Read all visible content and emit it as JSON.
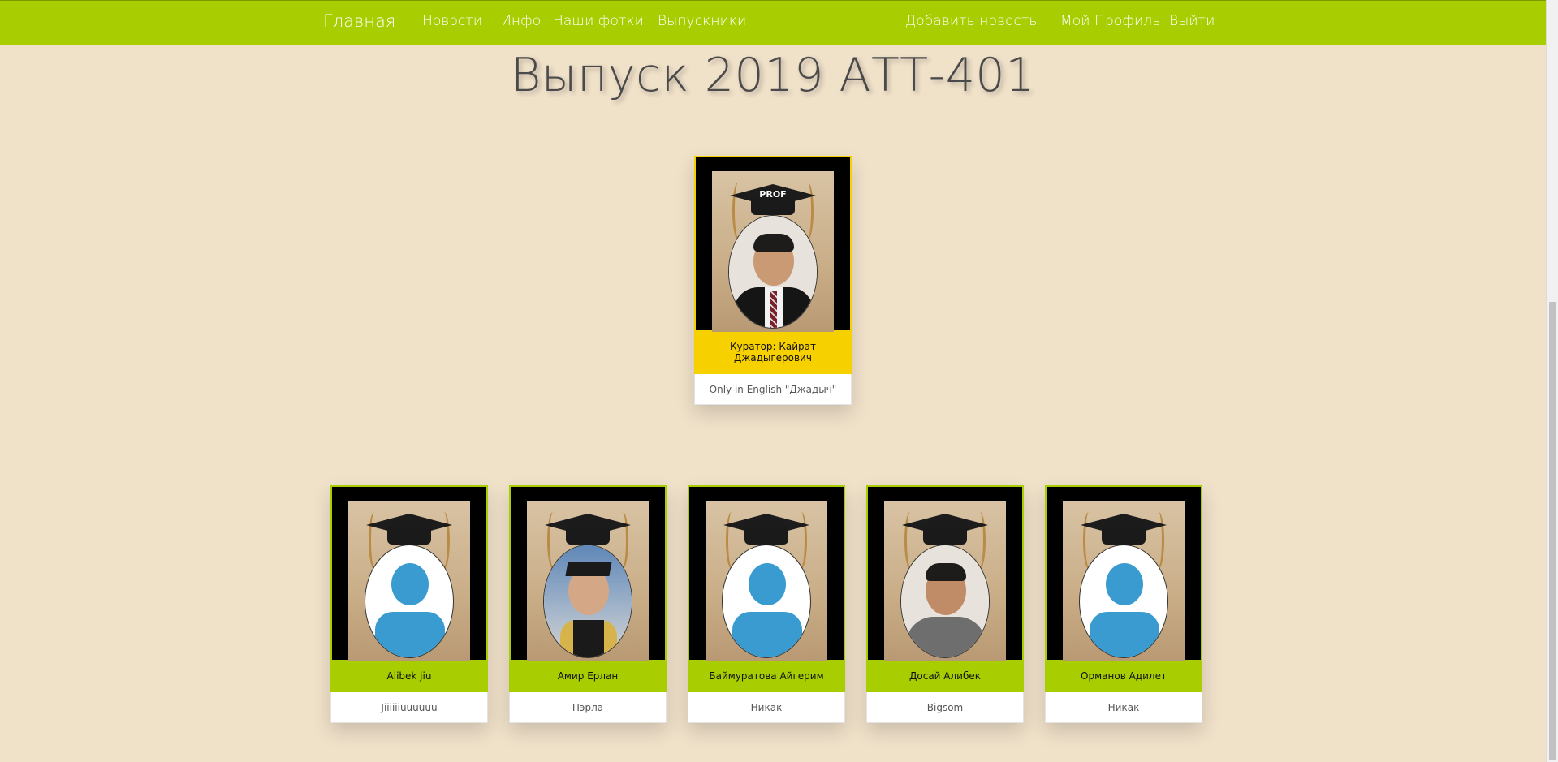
{
  "nav": {
    "brand": "Главная",
    "left_links": [
      "Новости",
      "Инфо",
      "Наши фотки",
      "Выпускники"
    ],
    "right_links": [
      "Добавить новость",
      "Мой Профиль",
      "Выйти"
    ],
    "bar_color": "#a8cd00"
  },
  "page": {
    "title": "Выпуск 2019 АТТ-401",
    "background": "#f0e1c9"
  },
  "curator": {
    "cap_label": "PROF",
    "name": "Куратор: Кайрат Джадыгерович",
    "nickname": "Only in English \"Джадыч\"",
    "strip_color": "#f7d000",
    "photo": "man-in-suit"
  },
  "graduates": [
    {
      "name": "Alibek jiu",
      "nickname": "Jiiiiiiuuuuuu",
      "photo": "default-avatar"
    },
    {
      "name": "Амир Ерлан",
      "nickname": "Пэрла",
      "photo": "graduation-photo"
    },
    {
      "name": "Баймуратова Айгерим",
      "nickname": "Никак",
      "photo": "default-avatar"
    },
    {
      "name": "Досай Алибек",
      "nickname": "Bigsom",
      "photo": "man-in-tshirt"
    },
    {
      "name": "Орманов Адилет",
      "nickname": "Никак",
      "photo": "default-avatar"
    }
  ],
  "colors": {
    "graduate_strip": "#a8cd00",
    "avatar_blue": "#3a9bd0"
  }
}
